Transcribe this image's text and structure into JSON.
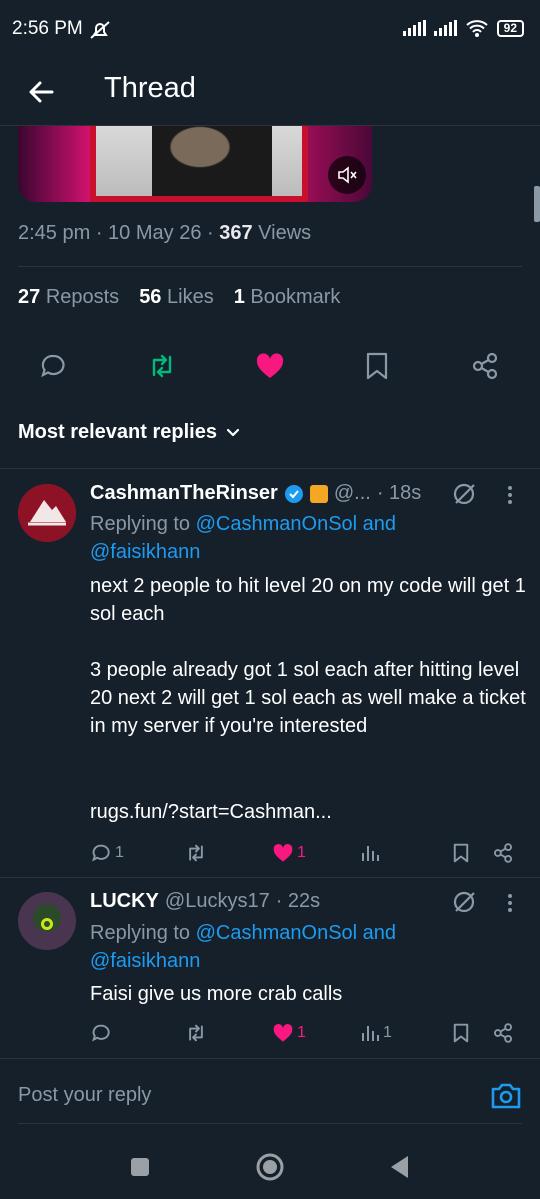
{
  "status_bar": {
    "time": "2:56 PM",
    "battery": "92"
  },
  "header": {
    "title": "Thread"
  },
  "tweet": {
    "time": "2:45 pm",
    "date": "10 May 26",
    "views_count": "367",
    "views_label": "Views",
    "reposts_count": "27",
    "reposts_label": "Reposts",
    "likes_count": "56",
    "likes_label": "Likes",
    "bookmarks_count": "1",
    "bookmarks_label": "Bookmark"
  },
  "replies_sort": {
    "label": "Most relevant replies"
  },
  "replies": [
    {
      "name": "CashmanTheRinser",
      "handle": "@...",
      "time": "· 18s",
      "replying_prefix": "Replying to ",
      "replying_to": "@CashmanOnSol and",
      "replying_to_2": "@faisikhann",
      "body": "next 2 people to hit level 20 on my code will get 1 sol each\n\n3 people already got 1 sol each after hitting level 20 next 2 will get 1 sol each as well make a ticket in my server if you're interested",
      "link": "rugs.fun/?start=Cashman...",
      "reply_count": "1",
      "like_count": "1",
      "views_count": ""
    },
    {
      "name": "LUCKY",
      "handle": "@Luckys17",
      "time": "· 22s",
      "replying_prefix": "Replying to ",
      "replying_to": "@CashmanOnSol and",
      "replying_to_2": "@faisikhann",
      "body": "Faisi give us more crab calls",
      "reply_count": "",
      "like_count": "1",
      "views_count": "1"
    }
  ],
  "composer": {
    "placeholder": "Post your reply"
  },
  "colors": {
    "background": "#15202b",
    "accent": "#1d9bf0",
    "like": "#f91880",
    "repost": "#00ba7c",
    "muted": "#8b98a5"
  }
}
